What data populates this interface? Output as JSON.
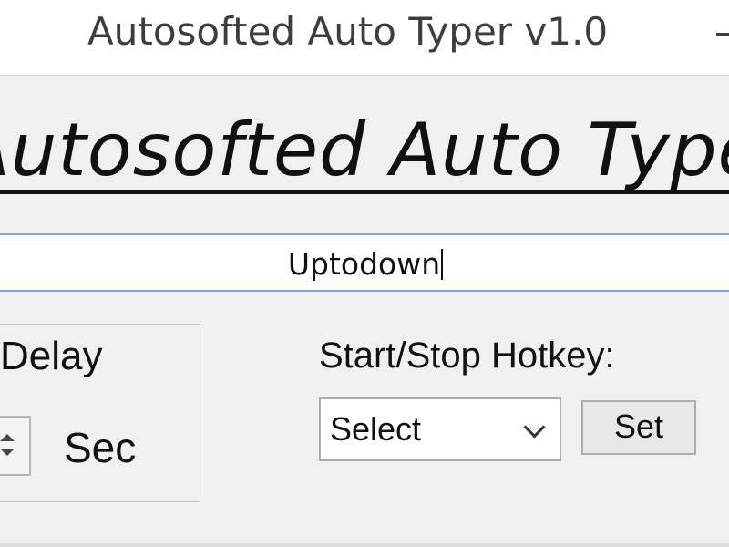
{
  "window": {
    "title": "Autosofted Auto Typer v1.0"
  },
  "banner": {
    "text": "Autosofted Auto Typer"
  },
  "text_input": {
    "value": "Uptodown"
  },
  "delay": {
    "label": "Delay",
    "unit_label": "Sec"
  },
  "hotkey": {
    "label": "Start/Stop Hotkey:",
    "select_value": "Select",
    "set_label": "Set"
  },
  "icons": {
    "dropdown": "chevron-down-icon",
    "spin_up": "arrow-up-icon",
    "spin_down": "arrow-down-icon",
    "minimize": "minimize-icon"
  }
}
